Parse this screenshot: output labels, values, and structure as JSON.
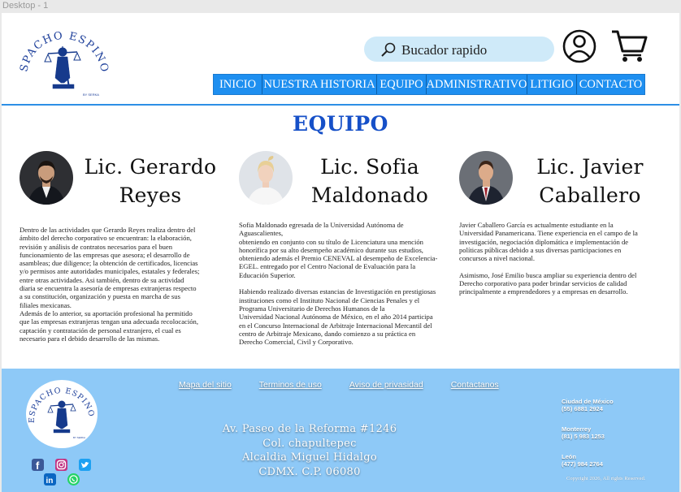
{
  "frame_label": "Desktop - 1",
  "brand": {
    "logo_text": "DESPACHO ESPINOZA",
    "logo_subtext": "BY SERKA"
  },
  "search": {
    "placeholder": "Bucador rapido"
  },
  "nav": [
    "INICIO",
    "NUESTRA HISTORIA",
    "EQUIPO",
    "ADMINISTRATIVO",
    "LITIGIO",
    "CONTACTO"
  ],
  "page_title": "EQUIPO",
  "team": [
    {
      "name_line1": "Lic.  Gerardo",
      "name_line2": "Reyes",
      "bio": [
        "Dentro de las actividades que Gerardo Reyes realiza dentro del\námbito del derecho corporativo se encuentran: la elaboración,\nrevisión y análisis de contratos necesarios para el buen\nfuncionamiento de las empresas que asesora; el desarrollo de\nasambleas; due diligence; la obtención de certificados, licencias\ny/o permisos ante autoridades municipales, estatales y federales;\nentre otras actividades. Asi también, dentro de su actividad\ndiaria se encuentra la asesoría de empresas extranjeras respecto\na su constitución, organización y puesta en marcha de sus\nfiliales mexicanas.\nAdemás de lo anterior, su aportación profesional ha permitido\nque las empresas extranjeras tengan una adecuada recolocación,\ncaptación y contratación de personal extranjero, el cual es\nnecesario para el debido desarrollo de las mismas."
      ]
    },
    {
      "name_line1": "Lic.  Sofia",
      "name_line2": "Maldonado",
      "bio": [
        "Sofia Maldonado egresada de la Universidad Autónoma de\nAguascalientes,\nobteniendo en conjunto con su título de Licenciatura una mención\nhonorífica por su alto desempeño académico durante sus estudios,\nobteniendo además el Premio CENEVAL al desempeño de Excelencia-\nEGEL. entregado por el Centro Nacional de Evaluación para la\nEducación Superior.",
        "Habiendo realizado diversas estancias de Investigación en prestigiosas\ninstituciones como el Instituto Nacional de Ciencias Penales y el\nPrograma Universitario de Derechos Humanos de la\nUniversidad Nacional Autónoma de México, en el año 2014 participa\nen el Concurso Internacional de Arbitraje Internacional Mercantil del\ncentro de Arbitraje Mexicano, dando comienzo a su práctica en\nDerecho Comercial,  Civil y Corporativo."
      ]
    },
    {
      "name_line1": "Lic.  Javier",
      "name_line2": "Caballero",
      "bio": [
        "Javier Caballero García es actualmente estudiante en la\nUniversidad Panamericana. Tiene experiencia en el campo de la\ninvestigación, negociación diplomática e implementación de\npolíticas públicas debido a sus diversas participaciones en\nconcursos a nivel nacional.",
        "Asimismo, José Emilio busca ampliar su experiencia dentro del\nDerecho corporativo para poder brindar servicios de calidad\nprincipalmente a emprendedores y a empresas en desarrollo."
      ]
    }
  ],
  "footer": {
    "links": [
      "Mapa del sitio",
      "Terminos de uso",
      "Aviso de privasidad",
      "Contactanos"
    ],
    "address": [
      "Av. Paseo de la Reforma #1246",
      "Col. chapultepec",
      "Alcaldia Miguel Hidalgo",
      "CDMX. C.P. 06080"
    ],
    "phones": [
      {
        "city": "Ciudad de México",
        "number": "(55) 6881 2924"
      },
      {
        "city": "Monterrey",
        "number": "(81) 5 983 1253"
      },
      {
        "city": "León",
        "number": "(477) 984 2764"
      }
    ],
    "copyright": "Copyright 2026, All rights Reserved."
  },
  "colors": {
    "accent": "#1e8ff0",
    "title": "#1650c8",
    "footer_bg": "#8ec9f7",
    "search_bg": "#cfeaf9"
  },
  "icons": [
    "search-icon",
    "user-icon",
    "cart-icon",
    "facebook-icon",
    "instagram-icon",
    "twitter-icon",
    "linkedin-icon",
    "whatsapp-icon"
  ]
}
